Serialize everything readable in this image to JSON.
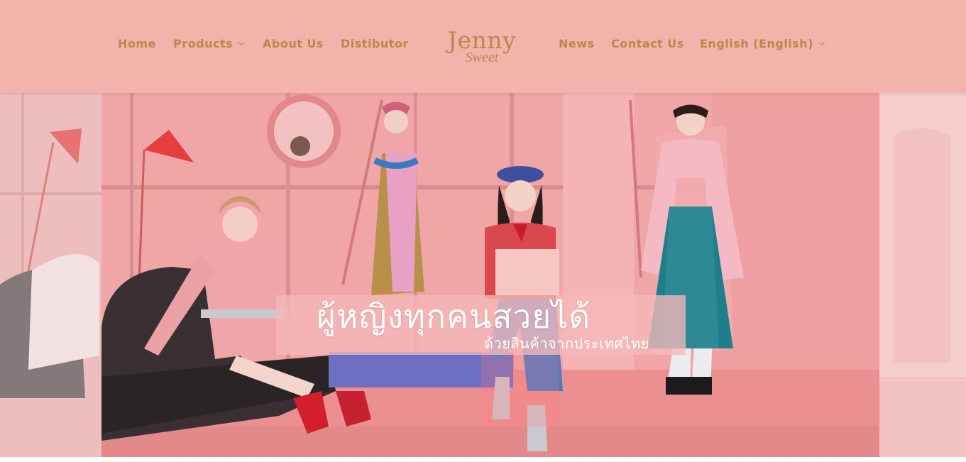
{
  "nav": {
    "home": "Home",
    "products": "Products",
    "about": "About Us",
    "distributor": "Distibutor",
    "news": "News",
    "contact": "Contact Us",
    "language": "English (English)"
  },
  "logo": {
    "line1": "Jenny",
    "line2": "Sweet"
  },
  "hero": {
    "headline": "ผู้หญิงทุกคนสวยได้",
    "subheadline": "ด้วยสินค้าจากประเทศไทย"
  },
  "colors": {
    "header_bg": "#f2b3ab",
    "nav_text": "#b8894a",
    "hero_bg": "#ec9a9c"
  }
}
